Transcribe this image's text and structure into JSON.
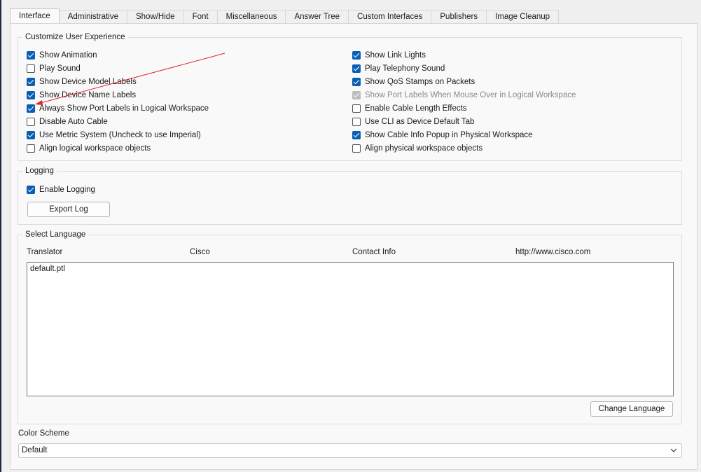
{
  "tabs": [
    "Interface",
    "Administrative",
    "Show/Hide",
    "Font",
    "Miscellaneous",
    "Answer Tree",
    "Custom Interfaces",
    "Publishers",
    "Image Cleanup"
  ],
  "active_tab": "Interface",
  "customize": {
    "title": "Customize User Experience",
    "left": [
      {
        "label": "Show Animation",
        "checked": true
      },
      {
        "label": "Play Sound",
        "checked": false
      },
      {
        "label": "Show Device Model Labels",
        "checked": true
      },
      {
        "label": "Show Device Name Labels",
        "checked": true
      },
      {
        "label": "Always Show Port Labels in Logical Workspace",
        "checked": true
      },
      {
        "label": "Disable Auto Cable",
        "checked": false
      },
      {
        "label": "Use Metric System (Uncheck to use Imperial)",
        "checked": true
      },
      {
        "label": "Align logical workspace objects",
        "checked": false
      }
    ],
    "right": [
      {
        "label": "Show Link Lights",
        "checked": true
      },
      {
        "label": "Play Telephony Sound",
        "checked": true
      },
      {
        "label": "Show QoS Stamps on Packets",
        "checked": true
      },
      {
        "label": "Show Port Labels When Mouse Over in Logical Workspace",
        "checked": true,
        "disabled": true
      },
      {
        "label": "Enable Cable Length Effects",
        "checked": false
      },
      {
        "label": "Use CLI as Device Default Tab",
        "checked": false
      },
      {
        "label": "Show Cable Info Popup in Physical Workspace",
        "checked": true
      },
      {
        "label": "Align physical workspace objects",
        "checked": false
      }
    ]
  },
  "logging": {
    "title": "Logging",
    "enable_label": "Enable Logging",
    "enable_checked": true,
    "export_label": "Export Log"
  },
  "language": {
    "title": "Select Language",
    "headers": [
      "Translator",
      "Cisco",
      "Contact Info",
      "http://www.cisco.com"
    ],
    "items": [
      "default.ptl"
    ],
    "change_label": "Change Language"
  },
  "color_scheme": {
    "label": "Color Scheme",
    "value": "Default"
  },
  "colors": {
    "accent": "#0a5fb4",
    "annotation_arrow": "#e0242c"
  }
}
